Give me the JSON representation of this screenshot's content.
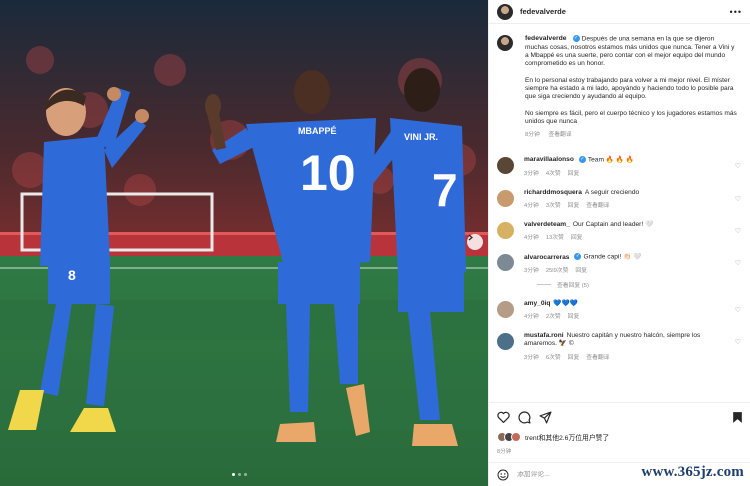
{
  "header": {
    "username": "fedevalverde",
    "more_icon": "more-horizontal-icon"
  },
  "post": {
    "username": "fedevalverde",
    "paragraphs": [
      "Después de una semana en la que se dijeron muchas cosas, nosotros estamos más unidos que nunca. Tener a Vini y a Mbappé es una suerte, pero contar con el mejor equipo del mundo comprometido es un honor.",
      "En lo personal estoy trabajando para volver a mi mejor nivel. El míster siempre ha estado a mi lado, apoyándo y haciendo todo lo posible para que siga creciendo y ayudando al equipo.",
      "No siempre es fácil, pero el cuerpo técnico y los jugadores estamos más unidos que nunca"
    ],
    "time": "8分钟",
    "translate": "查看翻译"
  },
  "comments": [
    {
      "user": "maravillaalonso",
      "verified": true,
      "text": "Team 🔥 🔥 🔥",
      "time": "3分钟",
      "likes": "4次赞",
      "reply": "回复",
      "avatar_color": "#5a4636"
    },
    {
      "user": "richarddmosquera",
      "verified": false,
      "text": "A seguir creciendo",
      "time": "4分钟",
      "likes": "3次赞",
      "reply": "回复",
      "translate": "查看翻译",
      "avatar_color": "#c99a6e"
    },
    {
      "user": "valverdeteam_",
      "verified": false,
      "text": "Our Captain and leader! 🤍",
      "time": "4分钟",
      "likes": "13次赞",
      "reply": "回复",
      "avatar_color": "#d7b163"
    },
    {
      "user": "alvarocarreras",
      "verified": true,
      "text": "Grande capi! 👏🏻 🤍",
      "time": "3分钟",
      "likes": "25l9次赞",
      "reply": "回复",
      "avatar_color": "#7d8a96",
      "replies": "查看回复 (5)"
    },
    {
      "user": "amy_0iq",
      "verified": false,
      "text": "💙💙💙",
      "time": "4分钟",
      "likes": "2次赞",
      "reply": "回复",
      "avatar_color": "#b59c86"
    },
    {
      "user": "mustafa.roni",
      "verified": false,
      "text": "Nuestro capitán y nuestro halcón, siempre los amaremos. 🦅 ©",
      "time": "3分钟",
      "likes": "6次赞",
      "reply": "回复",
      "translate": "查看翻译",
      "avatar_color": "#4c6f8a"
    }
  ],
  "likes_text": "trent和其他2.6万位用户赞了",
  "date": "8分钟",
  "composer": {
    "placeholder": "添加评论..."
  },
  "watermark": "www.365jz.com",
  "photo": {
    "jersey_name_center": "MBAPPÉ",
    "jersey_number_center": "10",
    "jersey_number_right": "7",
    "jersey_name_right": "VINI JR.",
    "jersey_number_left": "8"
  },
  "colors": {
    "jersey": "#2f6bd8",
    "link": "#3897f0",
    "pitch": "#2f6b3a"
  }
}
